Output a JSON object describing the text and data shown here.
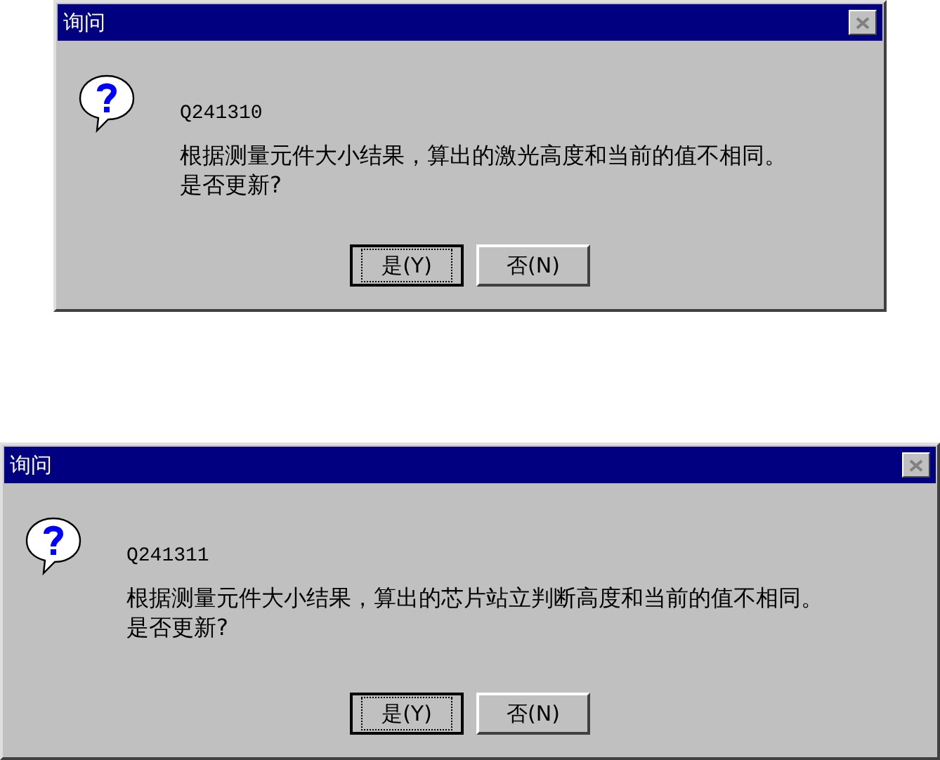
{
  "dialogs": [
    {
      "title": "询问",
      "code": "Q241310",
      "message": [
        "根据测量元件大小结果，算出的激光高度和当前的值不相同。",
        "是否更新?"
      ],
      "buttons": [
        {
          "label": "是(Y)",
          "default": true
        },
        {
          "label": "否(N)",
          "default": false
        }
      ]
    },
    {
      "title": "询问",
      "code": "Q241311",
      "message": [
        "根据测量元件大小结果，算出的芯片站立判断高度和当前的值不相同。",
        "是否更新?"
      ],
      "buttons": [
        {
          "label": "是(Y)",
          "default": true
        },
        {
          "label": "否(N)",
          "default": false
        }
      ]
    }
  ]
}
